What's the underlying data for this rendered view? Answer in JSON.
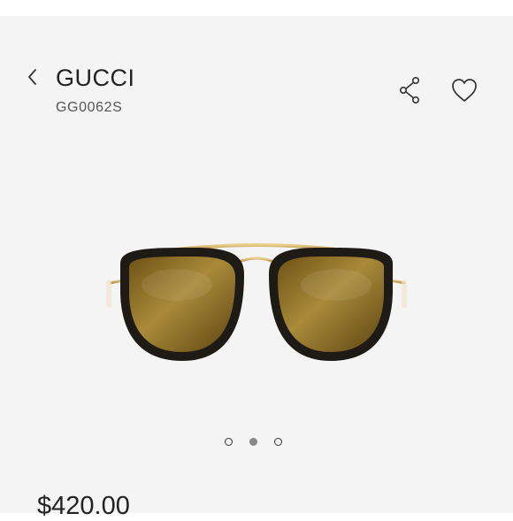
{
  "header": {
    "brand": "GUCCI",
    "model": "GG0062S",
    "back_icon": "chevron-left-icon",
    "share_icon": "share-icon",
    "favorite_icon": "heart-icon"
  },
  "gallery": {
    "total_images": 3,
    "active_index": 1
  },
  "product": {
    "price": "$420.00"
  },
  "colors": {
    "background": "#f4f4f4",
    "frame": "#1e1a16",
    "lens": "#8a6a1c",
    "metal": "#d6b46a"
  }
}
